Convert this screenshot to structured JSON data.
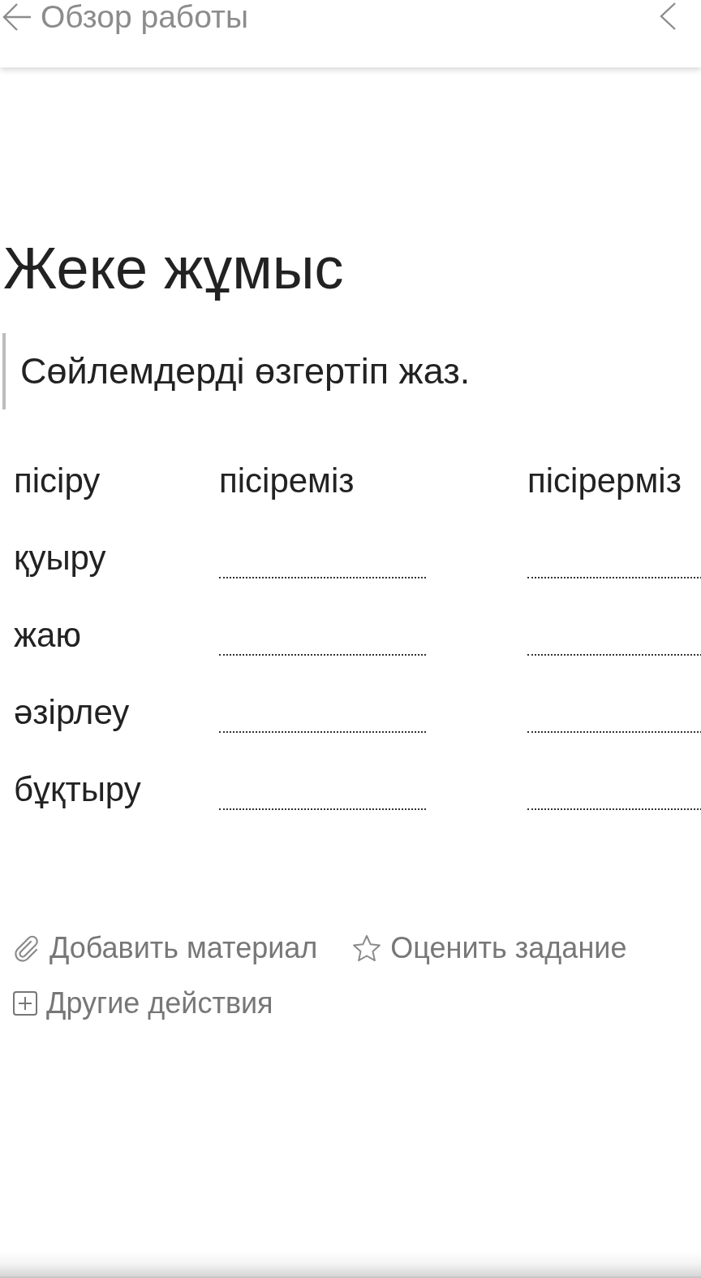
{
  "header": {
    "back_label": "Обзор работы"
  },
  "title": "Жеке жұмыс",
  "instruction": "Сөйлемдерді өзгертіп жаз.",
  "table": {
    "rows": [
      {
        "cells": [
          {
            "kind": "text",
            "text": "пісіру"
          },
          {
            "kind": "text",
            "text": "пісіреміз"
          },
          {
            "kind": "text",
            "text": "пісірерміз"
          }
        ]
      },
      {
        "cells": [
          {
            "kind": "text",
            "text": "қуыру"
          },
          {
            "kind": "blank"
          },
          {
            "kind": "blank"
          }
        ]
      },
      {
        "cells": [
          {
            "kind": "text",
            "text": "жаю"
          },
          {
            "kind": "blank"
          },
          {
            "kind": "blank"
          }
        ]
      },
      {
        "cells": [
          {
            "kind": "text",
            "text": "әзірлеу"
          },
          {
            "kind": "blank"
          },
          {
            "kind": "blank"
          }
        ]
      },
      {
        "cells": [
          {
            "kind": "text",
            "text": "бұқтыру"
          },
          {
            "kind": "blank"
          },
          {
            "kind": "blank"
          }
        ]
      }
    ]
  },
  "actions": [
    {
      "kind": "attach",
      "label": "Добавить материал"
    },
    {
      "kind": "rate",
      "label": "Оценить задание"
    },
    {
      "kind": "more",
      "label": "Другие действия"
    }
  ]
}
